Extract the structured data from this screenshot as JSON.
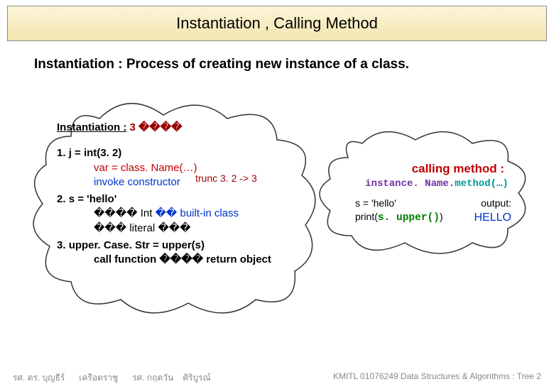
{
  "title": "Instantiation , Calling Method",
  "intro": "Instantiation : Process of creating new instance of a class.",
  "left_cloud": {
    "heading": {
      "label": "Instantiation :",
      "count": "3 ����"
    },
    "annot1": "trunc 3. 2 -> 3",
    "items": {
      "i1_label": "1.",
      "i1_text": "j = int(3. 2)",
      "i1_sub1": "var = class. Name(…)",
      "i1_sub2": "invoke constructor",
      "i2_label": "2.",
      "i2_text": "s = 'hello'",
      "i2_sub1_a": "���� Int",
      "i2_sub1_b": "�� built-in class",
      "i2_sub2": "��� literal ���",
      "i3_label": "3.",
      "i3_text": "upper. Case. Str = upper(s)",
      "i3_sub1": "call function ���� return object"
    }
  },
  "right_cloud": {
    "heading": "calling method :",
    "template": {
      "a": "instance. Name.",
      "b": "method(…)"
    },
    "example": {
      "l1": "s = 'hello'",
      "l2a": "print(",
      "l2b": "s. upper()",
      "l2c": ")",
      "out_label": "output:",
      "out_value": "HELLO"
    }
  },
  "footer": {
    "left_a": "รศ. ดร. บุญธีร์",
    "left_b": "เครือตราชู",
    "left_c": "รศ. กฤตวัน",
    "left_d": "ศิริบูรณ์",
    "right": "KMITL   01076249 Data Structures & Algorithms : Tree 2"
  }
}
